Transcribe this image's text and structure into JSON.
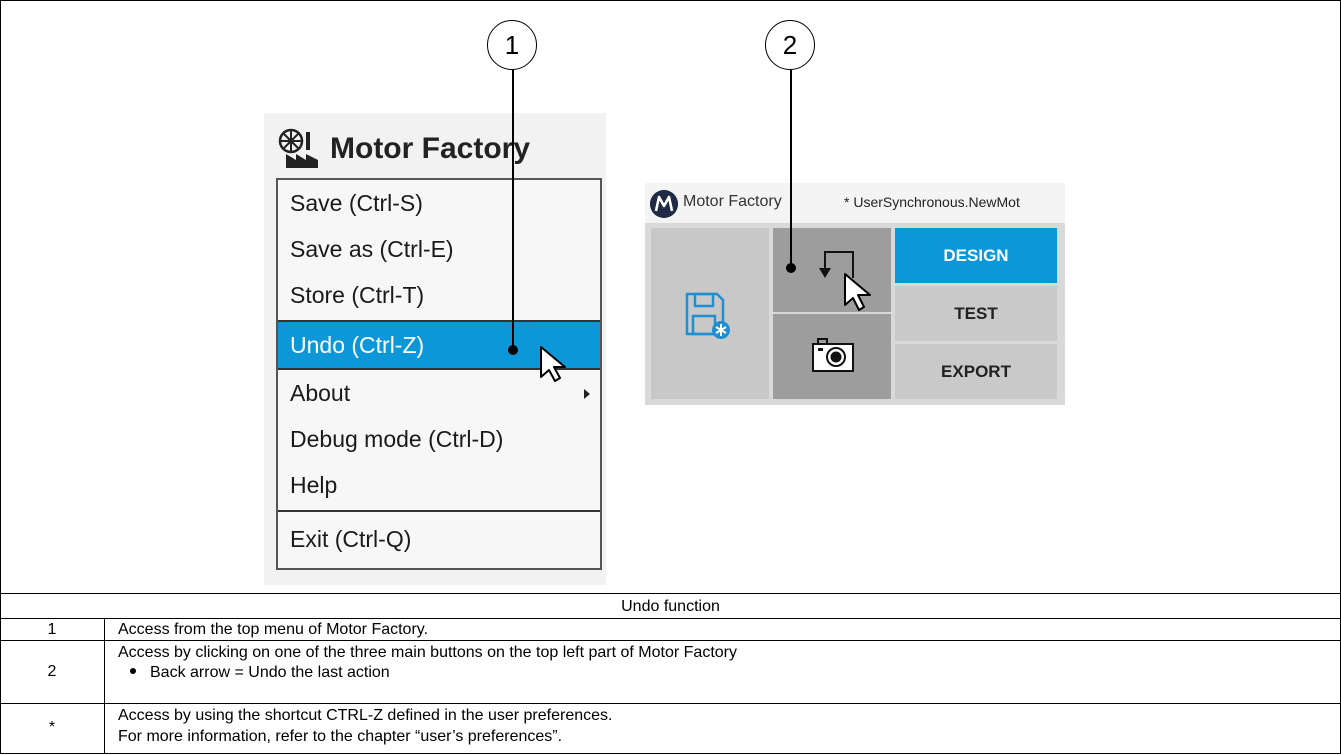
{
  "callouts": [
    "1",
    "2"
  ],
  "menu": {
    "app_name": "Motor Factory",
    "items": [
      {
        "label": "Save (Ctrl-S)"
      },
      {
        "label": "Save as (Ctrl-E)"
      },
      {
        "label": "Store (Ctrl-T)"
      },
      {
        "label": "Undo (Ctrl-Z)",
        "active": true
      },
      {
        "label": "About",
        "submenu": true
      },
      {
        "label": "Debug mode (Ctrl-D)"
      },
      {
        "label": "Help"
      },
      {
        "label": "Exit (Ctrl-Q)"
      }
    ],
    "accent_color": "#0b97d8"
  },
  "toolbar": {
    "app_name": "Motor Factory",
    "file_name": "* UserSynchronous.NewMot",
    "mode_buttons": [
      "DESIGN",
      "TEST",
      "EXPORT"
    ],
    "active_mode": "DESIGN",
    "icons": [
      "save-icon",
      "undo-arrow-icon",
      "camera-icon"
    ]
  },
  "caption": "Undo function",
  "rows": [
    {
      "num": "1",
      "lines": [
        "Access from the top menu of Motor Factory."
      ]
    },
    {
      "num": "2",
      "lines": [
        "Access by clicking on one of the three main buttons on the top left part of Motor Factory"
      ],
      "bullets": [
        "Back arrow = Undo the last action"
      ]
    },
    {
      "num": "*",
      "lines": [
        "Access by using the shortcut CTRL-Z defined in the user preferences.",
        "For more information, refer to the chapter “user’s preferences”."
      ]
    }
  ]
}
